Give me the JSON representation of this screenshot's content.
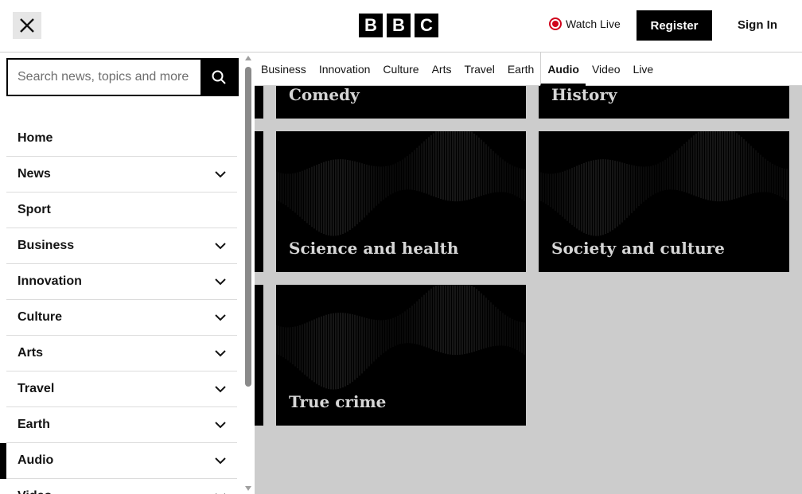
{
  "header": {
    "logo_letters": [
      "B",
      "B",
      "C"
    ],
    "watch_live": "Watch Live",
    "register": "Register",
    "sign_in": "Sign In"
  },
  "subnav": [
    "Business",
    "Innovation",
    "Culture",
    "Arts",
    "Travel",
    "Earth",
    "Audio",
    "Video",
    "Live"
  ],
  "subnav_active": "Audio",
  "search": {
    "placeholder": "Search news, topics and more"
  },
  "menu": [
    {
      "label": "Home",
      "expandable": false
    },
    {
      "label": "News",
      "expandable": true
    },
    {
      "label": "Sport",
      "expandable": false
    },
    {
      "label": "Business",
      "expandable": true
    },
    {
      "label": "Innovation",
      "expandable": true
    },
    {
      "label": "Culture",
      "expandable": true
    },
    {
      "label": "Arts",
      "expandable": true
    },
    {
      "label": "Travel",
      "expandable": true
    },
    {
      "label": "Earth",
      "expandable": true
    },
    {
      "label": "Audio",
      "expandable": true,
      "active": true
    },
    {
      "label": "Video",
      "expandable": true
    }
  ],
  "tiles": [
    {
      "title": "Comedy"
    },
    {
      "title": "History"
    },
    {
      "title": "Science and health"
    },
    {
      "title": "Society and culture"
    },
    {
      "title": "True crime"
    }
  ],
  "colors": {
    "live_red": "#d0021b",
    "brand_black": "#000000"
  }
}
